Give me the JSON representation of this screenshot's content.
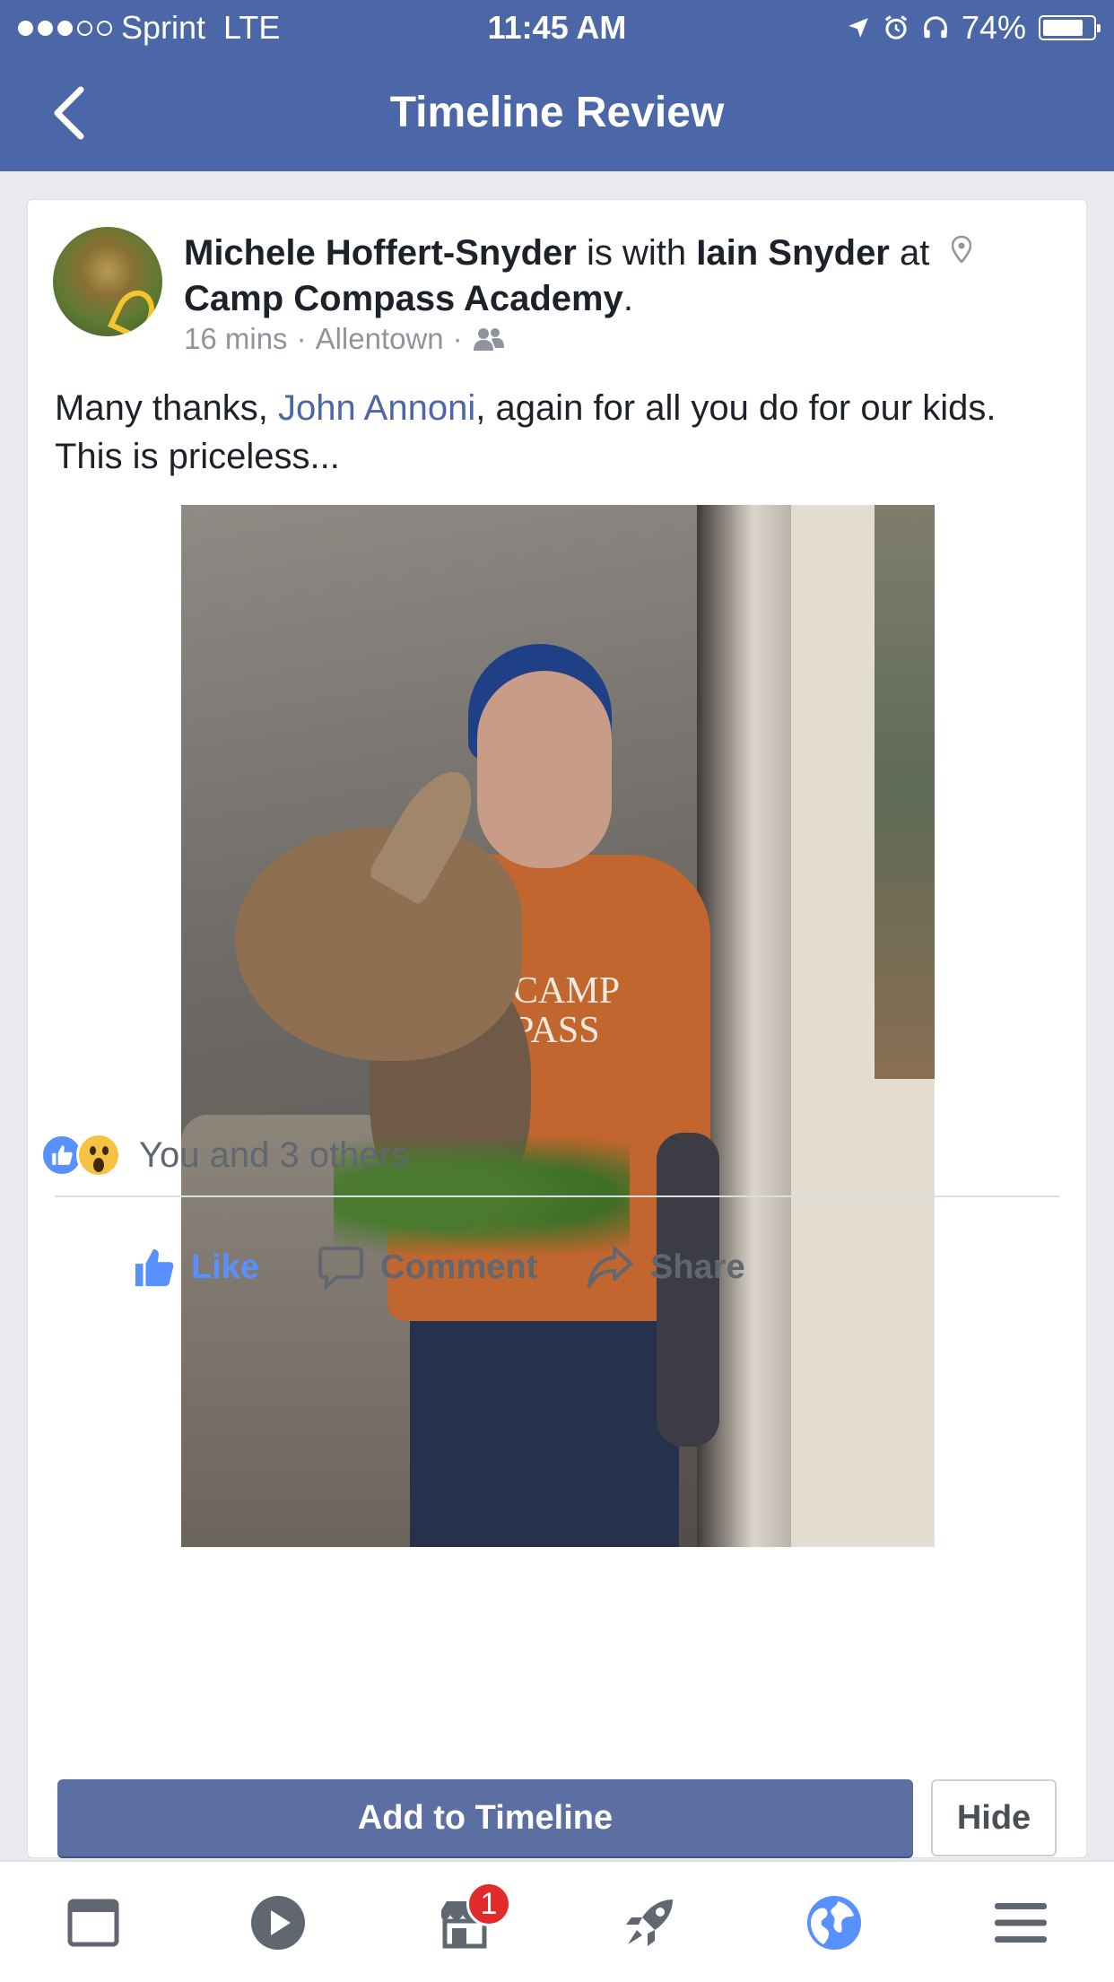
{
  "status_bar": {
    "carrier": "Sprint",
    "network": "LTE",
    "time": "11:45 AM",
    "battery": "74%",
    "battery_level": 0.74,
    "signal_bars_filled": 3,
    "signal_bars_total": 5
  },
  "nav": {
    "title": "Timeline Review",
    "back_icon": "chevron-left-icon"
  },
  "post": {
    "author": "Michele Hoffert-Snyder",
    "with_text": "is with",
    "tagged_person": "Iain Snyder",
    "at_text": "at",
    "place": "Camp Compass Academy",
    "place_suffix": ".",
    "time_ago": "16 mins",
    "location": "Allentown",
    "meta_separator": "·",
    "audience_icon": "friends-icon",
    "body_prefix": "Many thanks,",
    "body_mention": "John Annoni",
    "body_suffix": ", again for all you do for our kids. This is priceless...",
    "photo_shirt_text_1": "CAMP",
    "photo_shirt_text_2": "PASS",
    "reactions_text": "You and 3 others"
  },
  "actions": {
    "like": "Like",
    "comment": "Comment",
    "share": "Share"
  },
  "review": {
    "add_label": "Add to Timeline",
    "hide_label": "Hide"
  },
  "tabbar": {
    "badge_count": "1",
    "tabs": [
      "news-feed-icon",
      "video-icon",
      "marketplace-icon",
      "rocket-icon",
      "globe-icon",
      "menu-icon"
    ]
  },
  "colors": {
    "brand": "#4b67a8",
    "like_blue": "#5890ff",
    "badge_red": "#e32a2a"
  }
}
